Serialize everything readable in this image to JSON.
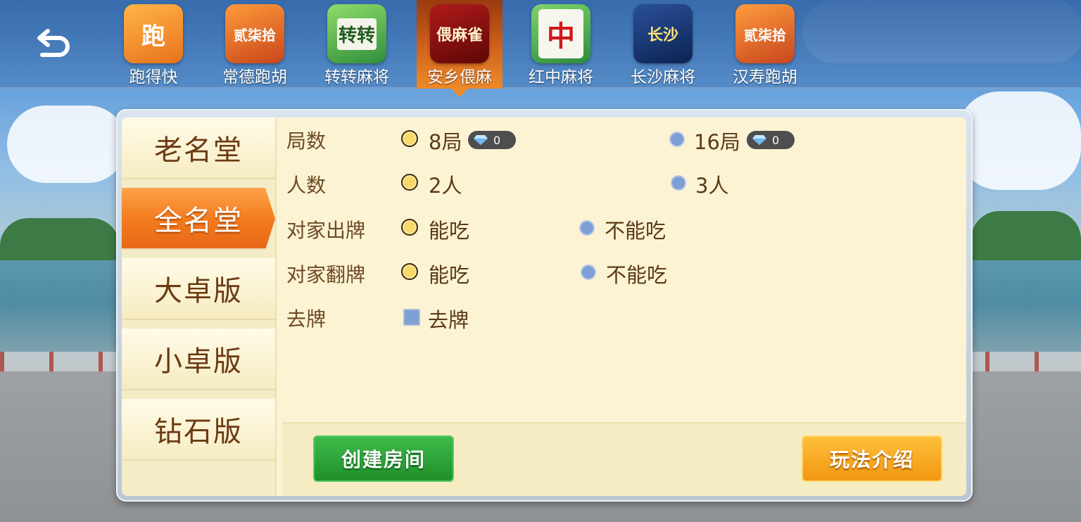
{
  "games": [
    {
      "name": "跑得快",
      "icon": "paodekuai-icon",
      "icon_text": "跑",
      "active": false
    },
    {
      "name": "常德跑胡",
      "icon": "changde-paohu-icon",
      "icon_text": "贰柒拾",
      "active": false
    },
    {
      "name": "转转麻将",
      "icon": "zhuanzhuan-mahjong-icon",
      "icon_text": "转转",
      "active": false
    },
    {
      "name": "安乡偎麻",
      "icon": "anxiang-weima-icon",
      "icon_text": "偎麻雀",
      "active": true
    },
    {
      "name": "红中麻将",
      "icon": "hongzhong-mahjong-icon",
      "icon_text": "中",
      "active": false
    },
    {
      "name": "长沙麻将",
      "icon": "changsha-mahjong-icon",
      "icon_text": "长沙",
      "active": false
    },
    {
      "name": "汉寿跑胡",
      "icon": "hanshou-paohu-icon",
      "icon_text": "贰柒拾",
      "active": false
    }
  ],
  "side_tabs": [
    {
      "label": "老名堂",
      "active": false
    },
    {
      "label": "全名堂",
      "active": true
    },
    {
      "label": "大卓版",
      "active": false
    },
    {
      "label": "小卓版",
      "active": false
    },
    {
      "label": "钻石版",
      "active": false
    }
  ],
  "options": {
    "rounds": {
      "label": "局数",
      "choices": [
        {
          "text": "8局",
          "selected": true,
          "cost": "0"
        },
        {
          "text": "16局",
          "selected": false,
          "cost": "0"
        }
      ]
    },
    "players": {
      "label": "人数",
      "choices": [
        {
          "text": "2人",
          "selected": true
        },
        {
          "text": "3人",
          "selected": false
        }
      ]
    },
    "opponent_discard": {
      "label": "对家出牌",
      "choices": [
        {
          "text": "能吃",
          "selected": true
        },
        {
          "text": "不能吃",
          "selected": false
        }
      ]
    },
    "opponent_flip": {
      "label": "对家翻牌",
      "choices": [
        {
          "text": "能吃",
          "selected": true
        },
        {
          "text": "不能吃",
          "selected": false
        }
      ]
    },
    "remove_cards": {
      "label": "去牌",
      "checkbox_text": "去牌",
      "checked": true
    }
  },
  "buttons": {
    "create": "创建房间",
    "rules": "玩法介绍"
  },
  "colors": {
    "active_tab": "#f27a1c",
    "create_button": "#2aa535",
    "rules_button": "#f5a11e",
    "panel_bg": "#fbf3d4"
  }
}
